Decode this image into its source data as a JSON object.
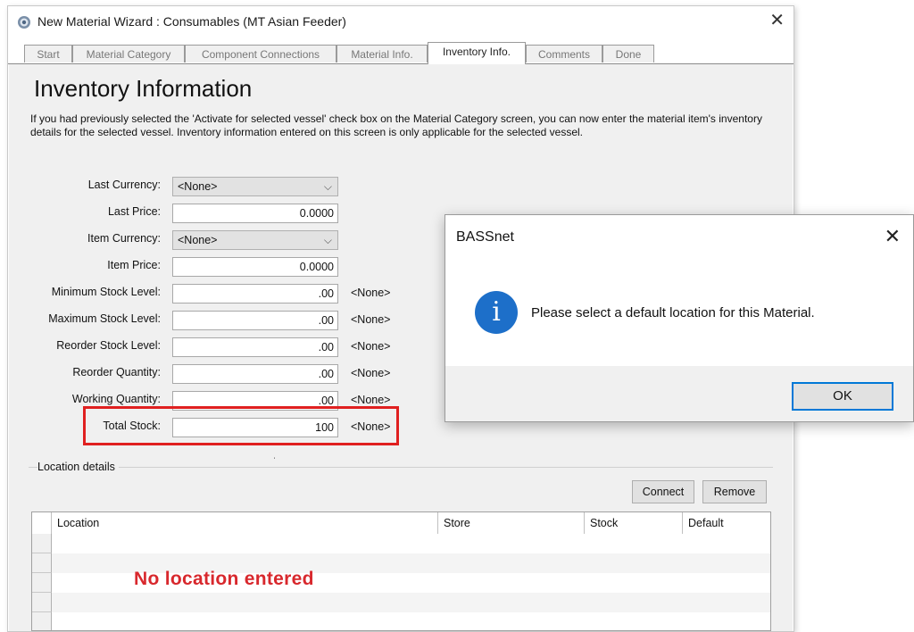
{
  "window": {
    "title": "New Material Wizard : Consumables (MT Asian Feeder)"
  },
  "tabs": [
    {
      "label": "Start"
    },
    {
      "label": "Material Category"
    },
    {
      "label": "Component Connections"
    },
    {
      "label": "Material Info."
    },
    {
      "label": "Inventory Info."
    },
    {
      "label": "Comments"
    },
    {
      "label": "Done"
    }
  ],
  "active_tab": "Inventory Info.",
  "page": {
    "heading": "Inventory Information",
    "description": "If you had previously selected the 'Activate for selected vessel' check box on the Material Category screen,  you can now enter the material item's inventory details for the selected vessel. Inventory information entered on this screen is only applicable for the selected vessel."
  },
  "form": {
    "last_currency": {
      "label": "Last Currency:",
      "value": "<None>"
    },
    "last_price": {
      "label": "Last Price:",
      "value": "0.0000"
    },
    "item_currency": {
      "label": "Item Currency:",
      "value": "<None>"
    },
    "item_price": {
      "label": "Item Price:",
      "value": "0.0000"
    },
    "minimum_stock": {
      "label": "Minimum Stock Level:",
      "value": ".00",
      "unit": "<None>"
    },
    "maximum_stock": {
      "label": "Maximum Stock Level:",
      "value": ".00",
      "unit": "<None>"
    },
    "reorder_stock": {
      "label": "Reorder Stock Level:",
      "value": ".00",
      "unit": "<None>"
    },
    "reorder_quantity": {
      "label": "Reorder Quantity:",
      "value": ".00",
      "unit": "<None>"
    },
    "working_quantity": {
      "label": "Working Quantity:",
      "value": ".00",
      "unit": "<None>"
    },
    "total_stock": {
      "label": "Total Stock:",
      "value": "100",
      "unit": "<None>"
    }
  },
  "location": {
    "group_label": "Location details",
    "connect_label": "Connect",
    "remove_label": "Remove",
    "columns": [
      "Location",
      "Store",
      "Stock",
      "Default"
    ],
    "empty_message": "No location entered"
  },
  "dialog": {
    "title": "BASSnet",
    "icon": "info-icon",
    "message": "Please select a default location for this Material.",
    "ok_label": "OK"
  },
  "colors": {
    "highlight": "#e02020",
    "empty_message": "#d8282d",
    "info_icon": "#1d6fc9",
    "focus_border": "#0078d7"
  }
}
